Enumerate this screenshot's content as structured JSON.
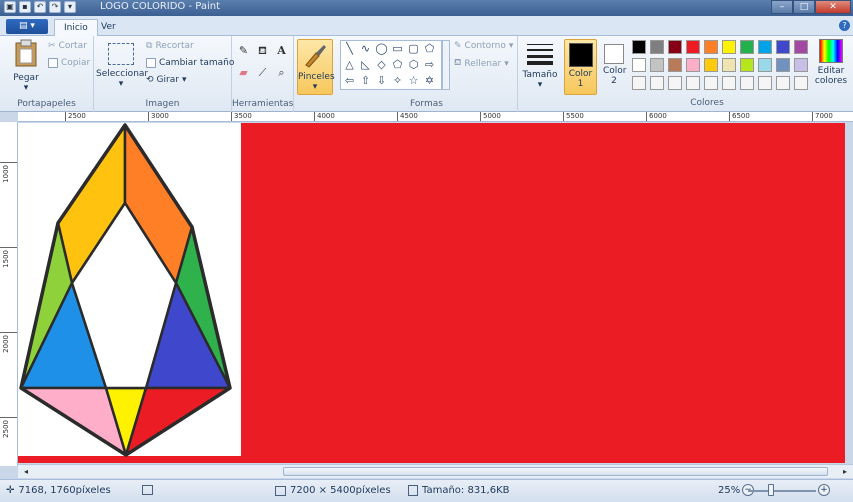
{
  "window": {
    "title": "LOGO COLORIDO - Paint"
  },
  "tabs": {
    "inicio": "Inicio",
    "ver": "Ver"
  },
  "clipboard": {
    "pegar": "Pegar",
    "cortar": "Cortar",
    "copiar": "Copiar",
    "group": "Portapapeles"
  },
  "image": {
    "seleccionar": "Seleccionar",
    "recortar": "Recortar",
    "cambiar": "Cambiar tamaño",
    "girar": "Girar",
    "group": "Imagen"
  },
  "tools": {
    "group": "Herramientas",
    "text_glyph": "A"
  },
  "brushes": {
    "label": "Pinceles"
  },
  "shapes": {
    "contorno": "Contorno",
    "rellenar": "Rellenar",
    "group": "Formas"
  },
  "size": {
    "label": "Tamaño"
  },
  "colors": {
    "color1": "Color 1",
    "color2": "Color 2",
    "editar": "Editar colores",
    "group": "Colores",
    "color1_value": "#000000",
    "color2_value": "#ffffff",
    "palette": [
      "#000000",
      "#7f7f7f",
      "#880015",
      "#ed1c24",
      "#ff7f27",
      "#fff200",
      "#22b14c",
      "#00a2e8",
      "#3f48cc",
      "#a349a4",
      "#ffffff",
      "#c3c3c3",
      "#b97a57",
      "#ffaec9",
      "#ffc90e",
      "#efe4b0",
      "#b5e61d",
      "#99d9ea",
      "#7092be",
      "#c8bfe7",
      "#f5f5f5",
      "#f5f5f5",
      "#f5f5f5",
      "#f5f5f5",
      "#f5f5f5",
      "#f5f5f5",
      "#f5f5f5",
      "#f5f5f5",
      "#f5f5f5",
      "#f5f5f5"
    ]
  },
  "ruler": {
    "h": [
      "2500",
      "3000",
      "3500",
      "4000",
      "4500",
      "5000",
      "5500",
      "6000",
      "6500",
      "7000"
    ],
    "v": [
      "1000",
      "1500",
      "2000",
      "2500"
    ]
  },
  "canvas": {
    "background": "#ec1c24",
    "facets": [
      "#ffc20e",
      "#ff7f27",
      "#8ed13a",
      "#2fb24c",
      "#1e90e8",
      "#3f48cc",
      "#ffaec9",
      "#fff200",
      "#ec1c24"
    ]
  },
  "status": {
    "position": "7168, 1760píxeles",
    "dimensions": "7200 × 5400píxeles",
    "size": "Tamaño: 831,6KB",
    "zoom": "25%"
  }
}
